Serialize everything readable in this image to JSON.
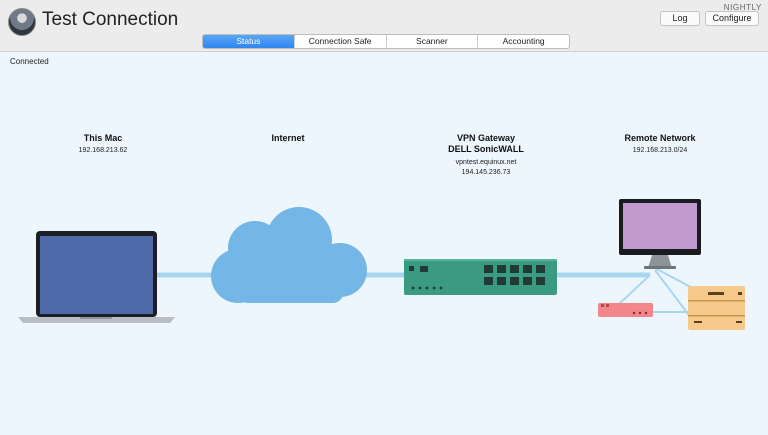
{
  "window": {
    "title": "Test Connection",
    "build_badge": "NIGHTLY",
    "log_button": "Log",
    "configure_button": "Configure"
  },
  "tabs": [
    {
      "label": "Status",
      "active": true
    },
    {
      "label": "Connection Safe",
      "active": false
    },
    {
      "label": "Scanner",
      "active": false
    },
    {
      "label": "Accounting",
      "active": false
    }
  ],
  "status": "Connected",
  "nodes": {
    "mac": {
      "title": "This Mac",
      "ip": "192.168.213.62"
    },
    "internet": {
      "title": "Internet"
    },
    "gateway": {
      "title": "VPN Gateway",
      "model": "DELL SonicWALL",
      "host": "vpntest.equinux.net",
      "ip": "194.145.236.73"
    },
    "remote": {
      "title": "Remote Network",
      "subnet": "192.168.213.0/24"
    }
  },
  "colors": {
    "accent": "#2f86ef",
    "link_line": "#a9d6ef",
    "laptop_screen": "#4f6aa8",
    "cloud": "#74b6e5",
    "gateway": "#3a9b82",
    "monitor_screen": "#c29ad0",
    "router": "#f2868a",
    "server": "#f7c98a"
  },
  "icons": [
    "laptop-icon",
    "cloud-icon",
    "gateway-appliance-icon",
    "monitor-icon",
    "router-icon",
    "server-icon"
  ]
}
